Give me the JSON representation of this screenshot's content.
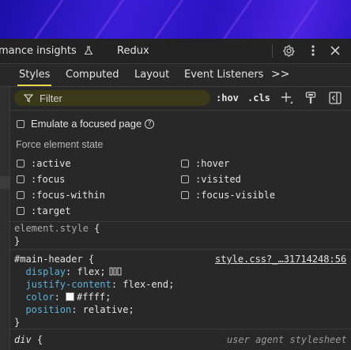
{
  "main_tabs": {
    "performance_label": "mance insights",
    "redux_label": "Redux"
  },
  "sub_tabs": [
    {
      "label": "Styles",
      "active": true
    },
    {
      "label": "Computed",
      "active": false
    },
    {
      "label": "Layout",
      "active": false
    },
    {
      "label": "Event Listeners",
      "active": false
    }
  ],
  "sub_tabs_more": ">>",
  "filter": {
    "placeholder": "Filter"
  },
  "toolbar": {
    "hov_label": ":hov",
    "cls_label": ".cls"
  },
  "emulate_focus": {
    "label": "Emulate a focused page",
    "help": "?"
  },
  "force_state": {
    "label": "Force element state",
    "left": [
      ":active",
      ":focus",
      ":focus-within",
      ":target"
    ],
    "right": [
      ":hover",
      ":visited",
      ":focus-visible"
    ]
  },
  "element_style": {
    "selector": "element.style",
    "open": " {",
    "close": "}"
  },
  "main_header_rule": {
    "selector": "#main-header",
    "open": " {",
    "source": "style.css?_…31714248:56",
    "decls": [
      {
        "prop": "display",
        "value": "flex;"
      },
      {
        "prop": "justify-content",
        "value": "flex-end;"
      },
      {
        "prop": "color",
        "value": "#ffff;"
      },
      {
        "prop": "position",
        "value": "relative;"
      }
    ],
    "close": "}"
  },
  "div_rule": {
    "selector": "div",
    "open": " {",
    "source": "user agent stylesheet"
  },
  "colors": {
    "accent": "#e8d44d",
    "property": "#5db0d7",
    "background": "#282828",
    "filter_bg": "#3b3a18"
  }
}
